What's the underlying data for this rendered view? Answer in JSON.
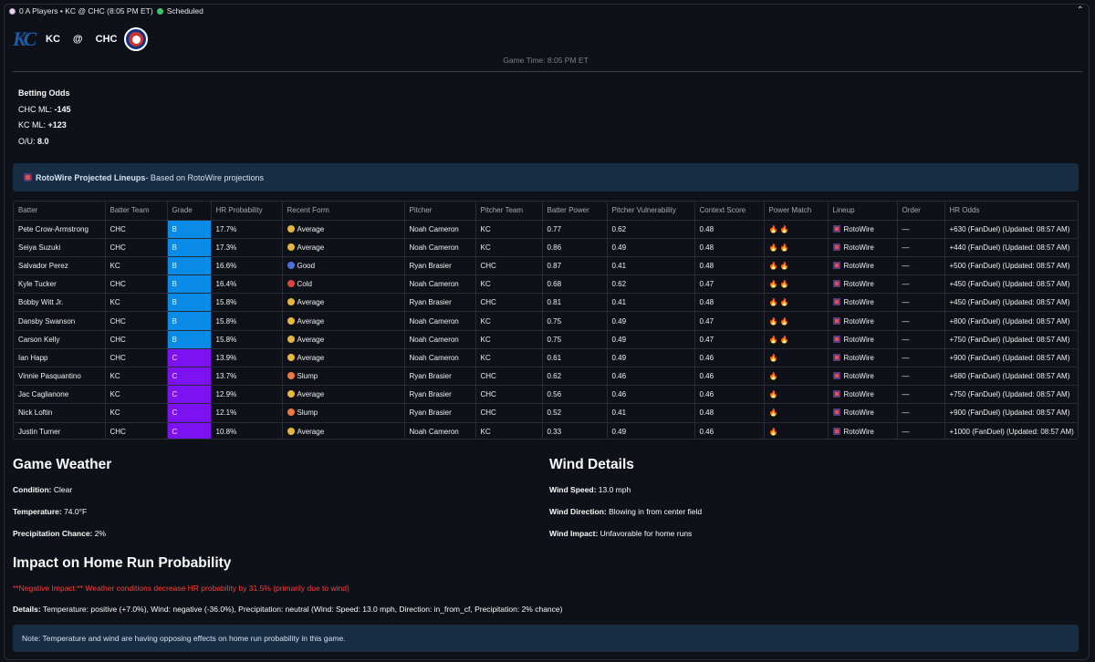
{
  "header": {
    "summary": "0 A Players • KC @ CHC (8:05 PM ET)",
    "status": "Scheduled"
  },
  "matchup": {
    "away": "KC",
    "at": "@",
    "home": "CHC",
    "away_logo_text": "KC",
    "game_time": "Game Time: 8:05 PM ET"
  },
  "odds": {
    "heading": "Betting Odds",
    "chc_label": "CHC ML: ",
    "chc_value": "-145",
    "kc_label": "KC ML: ",
    "kc_value": "+123",
    "ou_label": "O/U: ",
    "ou_value": "8.0"
  },
  "banner": {
    "title": "RotoWire Projected Lineups",
    "text": " - Based on RotoWire projections"
  },
  "table": {
    "columns": [
      "Batter",
      "Batter Team",
      "Grade",
      "HR Probability",
      "Recent Form",
      "Pitcher",
      "Pitcher Team",
      "Batter Power",
      "Pitcher Vulnerability",
      "Context Score",
      "Power Match",
      "Lineup",
      "Order",
      "HR Odds"
    ],
    "rows": [
      {
        "batter": "Pete Crow-Armstrong",
        "team": "CHC",
        "grade": "B",
        "hr": "17.7%",
        "form": "Average",
        "pitcher": "Noah Cameron",
        "pteam": "KC",
        "power": "0.77",
        "vuln": "0.62",
        "context": "0.48",
        "flames": 2,
        "lineup": "RotoWire",
        "order": "—",
        "odds": "+630 (FanDuel) (Updated: 08:57 AM)"
      },
      {
        "batter": "Seiya Suzuki",
        "team": "CHC",
        "grade": "B",
        "hr": "17.3%",
        "form": "Average",
        "pitcher": "Noah Cameron",
        "pteam": "KC",
        "power": "0.86",
        "vuln": "0.49",
        "context": "0.48",
        "flames": 2,
        "lineup": "RotoWire",
        "order": "—",
        "odds": "+440 (FanDuel) (Updated: 08:57 AM)"
      },
      {
        "batter": "Salvador Perez",
        "team": "KC",
        "grade": "B",
        "hr": "16.6%",
        "form": "Good",
        "pitcher": "Ryan Brasier",
        "pteam": "CHC",
        "power": "0.87",
        "vuln": "0.41",
        "context": "0.48",
        "flames": 2,
        "lineup": "RotoWire",
        "order": "—",
        "odds": "+500 (FanDuel) (Updated: 08:57 AM)"
      },
      {
        "batter": "Kyle Tucker",
        "team": "CHC",
        "grade": "B",
        "hr": "16.4%",
        "form": "Cold",
        "pitcher": "Noah Cameron",
        "pteam": "KC",
        "power": "0.68",
        "vuln": "0.62",
        "context": "0.47",
        "flames": 2,
        "lineup": "RotoWire",
        "order": "—",
        "odds": "+450 (FanDuel) (Updated: 08:57 AM)"
      },
      {
        "batter": "Bobby Witt Jr.",
        "team": "KC",
        "grade": "B",
        "hr": "15.8%",
        "form": "Average",
        "pitcher": "Ryan Brasier",
        "pteam": "CHC",
        "power": "0.81",
        "vuln": "0.41",
        "context": "0.48",
        "flames": 2,
        "lineup": "RotoWire",
        "order": "—",
        "odds": "+450 (FanDuel) (Updated: 08:57 AM)"
      },
      {
        "batter": "Dansby Swanson",
        "team": "CHC",
        "grade": "B",
        "hr": "15.8%",
        "form": "Average",
        "pitcher": "Noah Cameron",
        "pteam": "KC",
        "power": "0.75",
        "vuln": "0.49",
        "context": "0.47",
        "flames": 2,
        "lineup": "RotoWire",
        "order": "—",
        "odds": "+800 (FanDuel) (Updated: 08:57 AM)"
      },
      {
        "batter": "Carson Kelly",
        "team": "CHC",
        "grade": "B",
        "hr": "15.8%",
        "form": "Average",
        "pitcher": "Noah Cameron",
        "pteam": "KC",
        "power": "0.75",
        "vuln": "0.49",
        "context": "0.47",
        "flames": 2,
        "lineup": "RotoWire",
        "order": "—",
        "odds": "+750 (FanDuel) (Updated: 08:57 AM)"
      },
      {
        "batter": "Ian Happ",
        "team": "CHC",
        "grade": "C",
        "hr": "13.9%",
        "form": "Average",
        "pitcher": "Noah Cameron",
        "pteam": "KC",
        "power": "0.61",
        "vuln": "0.49",
        "context": "0.46",
        "flames": 1,
        "lineup": "RotoWire",
        "order": "—",
        "odds": "+900 (FanDuel) (Updated: 08:57 AM)"
      },
      {
        "batter": "Vinnie Pasquantino",
        "team": "KC",
        "grade": "C",
        "hr": "13.7%",
        "form": "Slump",
        "pitcher": "Ryan Brasier",
        "pteam": "CHC",
        "power": "0.62",
        "vuln": "0.46",
        "context": "0.46",
        "flames": 1,
        "lineup": "RotoWire",
        "order": "—",
        "odds": "+680 (FanDuel) (Updated: 08:57 AM)"
      },
      {
        "batter": "Jac Caglianone",
        "team": "KC",
        "grade": "C",
        "hr": "12.9%",
        "form": "Average",
        "pitcher": "Ryan Brasier",
        "pteam": "CHC",
        "power": "0.56",
        "vuln": "0.46",
        "context": "0.46",
        "flames": 1,
        "lineup": "RotoWire",
        "order": "—",
        "odds": "+750 (FanDuel) (Updated: 08:57 AM)"
      },
      {
        "batter": "Nick Loftin",
        "team": "KC",
        "grade": "C",
        "hr": "12.1%",
        "form": "Slump",
        "pitcher": "Ryan Brasier",
        "pteam": "CHC",
        "power": "0.52",
        "vuln": "0.41",
        "context": "0.48",
        "flames": 1,
        "lineup": "RotoWire",
        "order": "—",
        "odds": "+900 (FanDuel) (Updated: 08:57 AM)"
      },
      {
        "batter": "Justin Turner",
        "team": "CHC",
        "grade": "C",
        "hr": "10.8%",
        "form": "Average",
        "pitcher": "Noah Cameron",
        "pteam": "KC",
        "power": "0.33",
        "vuln": "0.49",
        "context": "0.46",
        "flames": 1,
        "lineup": "RotoWire",
        "order": "—",
        "odds": "+1000 (FanDuel) (Updated: 08:57 AM)"
      }
    ]
  },
  "weather": {
    "heading": "Game Weather",
    "condition_label": "Condition:",
    "condition": " Clear",
    "temp_label": "Temperature:",
    "temp": " 74.0°F",
    "precip_label": "Precipitation Chance:",
    "precip": " 2%"
  },
  "wind": {
    "heading": "Wind Details",
    "speed_label": "Wind Speed:",
    "speed": " 13.0 mph",
    "direction_label": "Wind Direction:",
    "direction": " Blowing in from center field",
    "impact_label": "Wind Impact:",
    "impact": " Unfavorable for home runs"
  },
  "impact": {
    "heading": "Impact on Home Run Probability",
    "negative": "**Negative Impact:** Weather conditions decrease HR probability by 31.5% (primarily due to wind)",
    "details_label": "Details:",
    "details": " Temperature: positive (+7.0%), Wind: negative (-36.0%), Precipitation: neutral (Wind: Speed: 13.0 mph, Direction: in_from_cf, Precipitation: 2% chance)",
    "note": "Note: Temperature and wind are having opposing effects on home run probability in this game."
  },
  "colors": {
    "grade_B": "#0a8be8",
    "grade_C": "#7c12f0",
    "negative_text": "#ff3b3b",
    "banner_bg": "#172d43"
  }
}
